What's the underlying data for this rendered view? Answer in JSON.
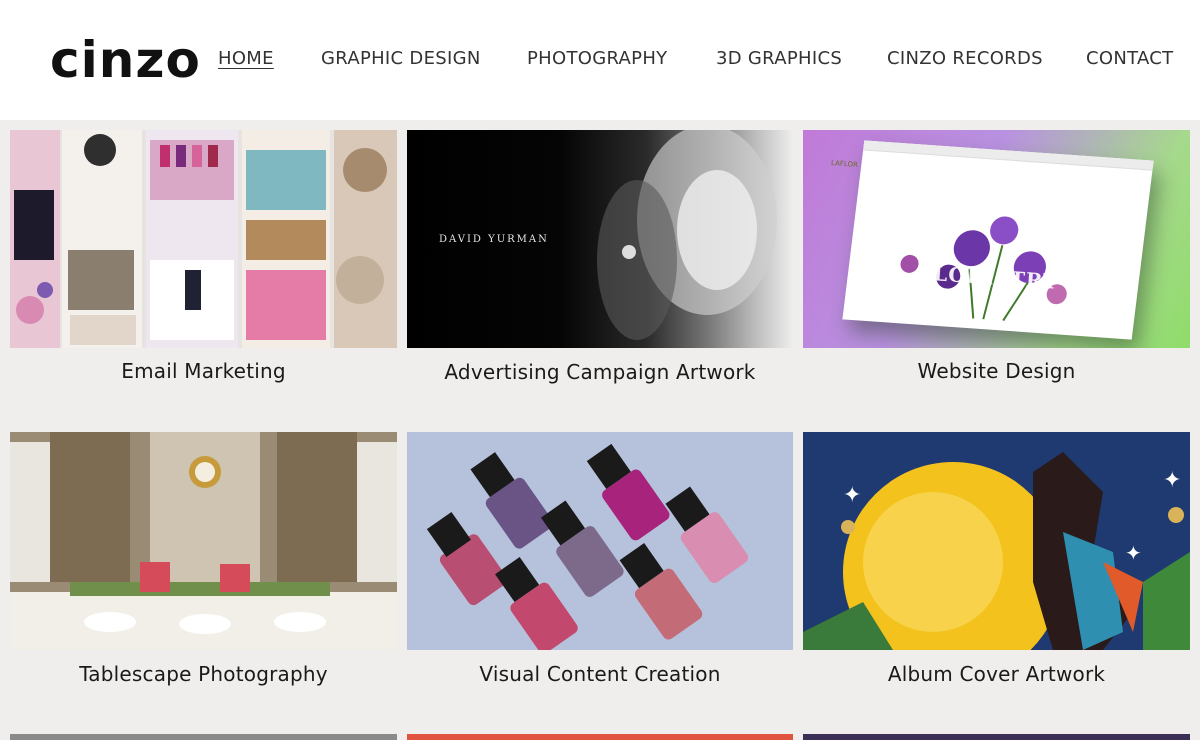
{
  "header": {
    "logo": "cinzo",
    "nav": [
      {
        "label": "HOME",
        "active": true
      },
      {
        "label": "GRAPHIC DESIGN",
        "active": false
      },
      {
        "label": "PHOTOGRAPHY",
        "active": false
      },
      {
        "label": "3D GRAPHICS",
        "active": false
      },
      {
        "label": "CINZO RECORDS",
        "active": false
      },
      {
        "label": "CONTACT",
        "active": false
      }
    ]
  },
  "portfolio": {
    "items": [
      {
        "caption": "Email Marketing",
        "image": "email-marketing-collage"
      },
      {
        "caption": "Advertising Campaign Artwork",
        "image": "bw-jewelry-campaign",
        "image_text": "DAVID YURMAN"
      },
      {
        "caption": "Website Design",
        "image": "floristry-website-mockup",
        "image_text": "FLORISTRY",
        "image_logo": "LAFLOR"
      },
      {
        "caption": "Tablescape Photography",
        "image": "tablescape-dining-room"
      },
      {
        "caption": "Visual Content Creation",
        "image": "nail-polish-bottles"
      },
      {
        "caption": "Album Cover Artwork",
        "image": "album-cover-illustration"
      }
    ]
  },
  "colors": {
    "page_bg": "#f0eeec",
    "header_bg": "#ffffff",
    "text": "#1a1a1a"
  }
}
